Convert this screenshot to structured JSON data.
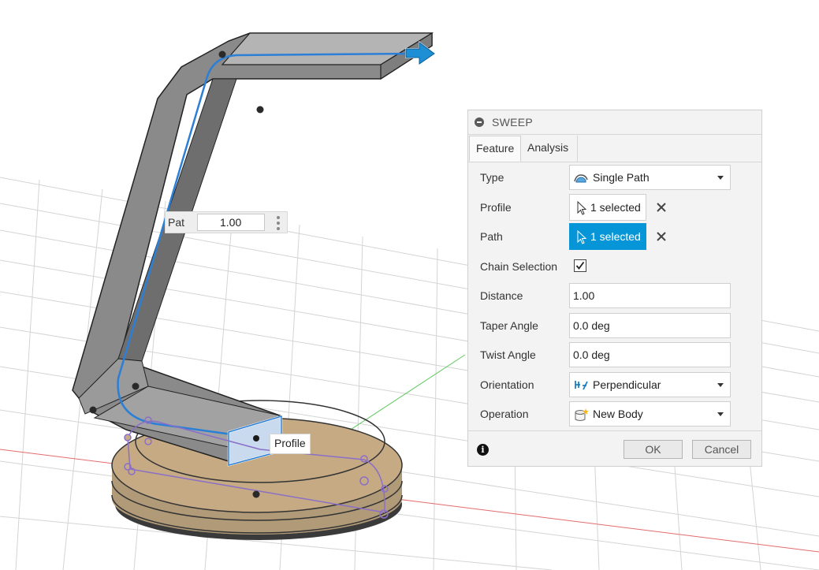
{
  "viewport": {
    "path_distance_label": "Pat",
    "path_distance_value": "1.00",
    "profile_tag": "Profile"
  },
  "dialog": {
    "title": "SWEEP",
    "tabs": [
      "Feature",
      "Analysis"
    ],
    "rows": {
      "type": {
        "label": "Type",
        "value": "Single Path",
        "icon": "single-path-icon"
      },
      "profile": {
        "label": "Profile",
        "value": "1 selected",
        "icon": "cursor-arrow-icon"
      },
      "path": {
        "label": "Path",
        "value": "1 selected",
        "icon": "cursor-arrow-icon"
      },
      "chain_selection": {
        "label": "Chain Selection",
        "checked": true
      },
      "distance": {
        "label": "Distance",
        "value": "1.00"
      },
      "taper_angle": {
        "label": "Taper Angle",
        "value": "0.0 deg"
      },
      "twist_angle": {
        "label": "Twist Angle",
        "value": "0.0 deg"
      },
      "orientation": {
        "label": "Orientation",
        "value": "Perpendicular",
        "icon": "perpendicular-icon"
      },
      "operation": {
        "label": "Operation",
        "value": "New Body",
        "icon": "new-body-icon"
      }
    },
    "buttons": {
      "ok": "OK",
      "cancel": "Cancel"
    },
    "colors": {
      "active_selection": "#0696d7"
    }
  }
}
